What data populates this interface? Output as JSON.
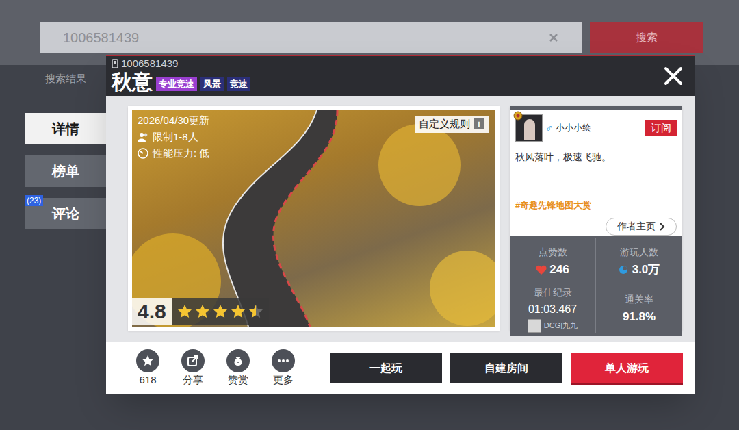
{
  "background": {
    "search": {
      "value": "1006581439"
    },
    "search_button": "搜索",
    "results_label": "搜索结果"
  },
  "side_tabs": [
    {
      "label": "详情",
      "selected": true
    },
    {
      "label": "榜单",
      "selected": false
    },
    {
      "label": "评论",
      "selected": false,
      "badge": "(23)"
    }
  ],
  "map": {
    "id": "1006581439",
    "title": "秋意",
    "tags": [
      {
        "label": "专业竞速",
        "color": "#9a3fd0"
      },
      {
        "label": "风景",
        "color": "#2b2f78"
      },
      {
        "label": "竞速",
        "color": "#2b2f78"
      }
    ],
    "updated": "2026/04/30更新",
    "players": "限制1-8人",
    "performance": "性能压力: 低",
    "custom_rules": "自定义规则",
    "info_icon": "i",
    "rating": "4.8",
    "stars": 4.5
  },
  "author": {
    "name": "小小小绘",
    "gender": "♂",
    "subscribe": "订阅",
    "description": "秋风落叶，极速飞驰。",
    "topic": "#奇趣先锋地图大赏",
    "homepage": "作者主页"
  },
  "stats": [
    {
      "kind": "likes",
      "label": "点赞数",
      "value": "246"
    },
    {
      "kind": "players",
      "label": "游玩人数",
      "value": "3.0万"
    },
    {
      "kind": "record",
      "label": "最佳纪录",
      "value": "01:03.467",
      "holder": "DCG|九九"
    },
    {
      "kind": "rate",
      "label": "通关率",
      "value": "91.8%"
    }
  ],
  "actions": [
    {
      "kind": "star",
      "label": "618"
    },
    {
      "kind": "share",
      "label": "分享"
    },
    {
      "kind": "reward",
      "label": "赞赏"
    },
    {
      "kind": "more",
      "label": "更多"
    }
  ],
  "buttons": [
    {
      "kind": "secondary",
      "label": "一起玩"
    },
    {
      "kind": "secondary",
      "label": "自建房间"
    },
    {
      "kind": "primary",
      "label": "单人游玩"
    }
  ]
}
